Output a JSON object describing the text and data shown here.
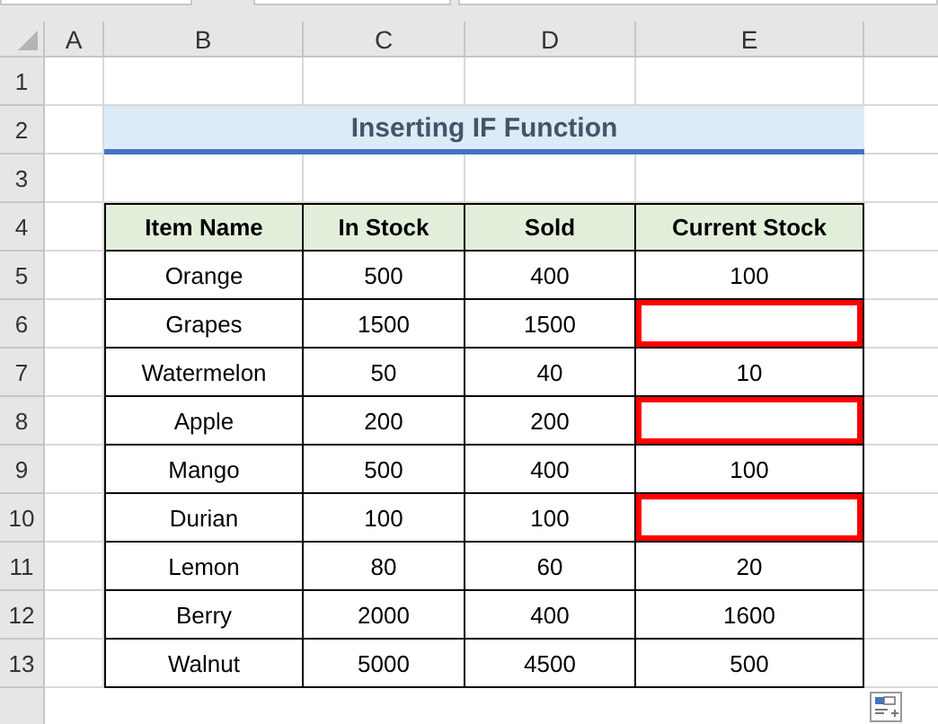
{
  "column_headers": [
    "A",
    "B",
    "C",
    "D",
    "E"
  ],
  "row_numbers": [
    "1",
    "2",
    "3",
    "4",
    "5",
    "6",
    "7",
    "8",
    "9",
    "10",
    "11",
    "12",
    "13"
  ],
  "title": "Inserting IF Function",
  "table": {
    "columns": [
      "Item Name",
      "In Stock",
      "Sold",
      "Current Stock"
    ],
    "rows": [
      {
        "item": "Orange",
        "in_stock": "500",
        "sold": "400",
        "current_stock": "100",
        "highlighted": false
      },
      {
        "item": "Grapes",
        "in_stock": "1500",
        "sold": "1500",
        "highlighted": true
      },
      {
        "item": "Watermelon",
        "in_stock": "50",
        "sold": "40",
        "current_stock": "10",
        "highlighted": false
      },
      {
        "item": "Apple",
        "in_stock": "200",
        "sold": "200",
        "highlighted": true
      },
      {
        "item": "Mango",
        "in_stock": "500",
        "sold": "400",
        "current_stock": "100",
        "highlighted": false
      },
      {
        "item": "Durian",
        "in_stock": "100",
        "sold": "100",
        "highlighted": true
      },
      {
        "item": "Lemon",
        "in_stock": "80",
        "sold": "60",
        "current_stock": "20",
        "highlighted": false
      },
      {
        "item": "Berry",
        "in_stock": "2000",
        "sold": "400",
        "current_stock": "1600",
        "highlighted": false
      },
      {
        "item": "Walnut",
        "in_stock": "5000",
        "sold": "4500",
        "current_stock": "500",
        "highlighted": false
      }
    ]
  }
}
